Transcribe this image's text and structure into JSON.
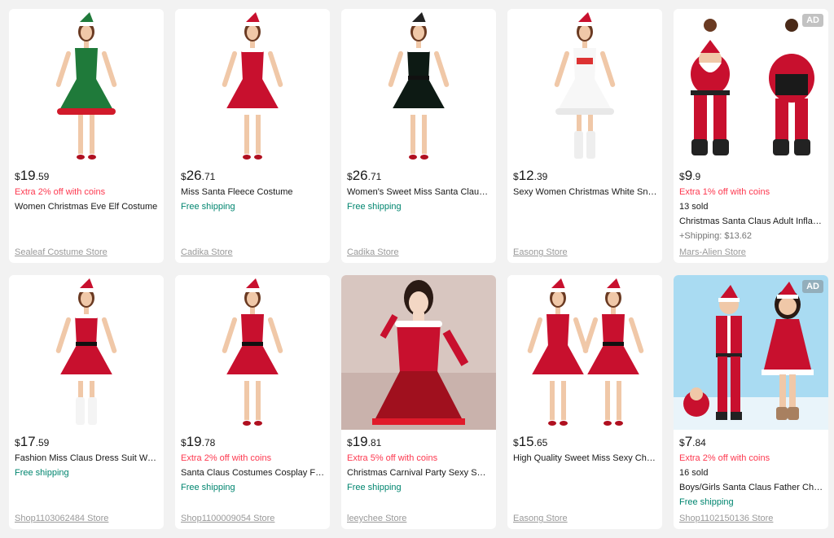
{
  "ad_label": "AD",
  "products": [
    {
      "cur": "$",
      "int": "19",
      "dec": ".59",
      "lines": [
        {
          "kind": "promo",
          "text": "Extra 2% off with coins"
        },
        {
          "kind": "title",
          "text": "Women Christmas Eve Elf Costume"
        }
      ],
      "store": "Sealeaf Costume Store",
      "ad": false,
      "image": "green-elf-dress"
    },
    {
      "cur": "$",
      "int": "26",
      "dec": ".71",
      "lines": [
        {
          "kind": "title",
          "text": "Miss Santa Fleece Costume"
        },
        {
          "kind": "ship-free",
          "text": "Free shipping"
        }
      ],
      "store": "Cadika Store",
      "ad": false,
      "image": "red-santa-dress-cape"
    },
    {
      "cur": "$",
      "int": "26",
      "dec": ".71",
      "lines": [
        {
          "kind": "title",
          "text": "Women's Sweet Miss Santa Claus Costume"
        },
        {
          "kind": "ship-free",
          "text": "Free shipping"
        }
      ],
      "store": "Cadika Store",
      "ad": false,
      "image": "black-velvet-dress"
    },
    {
      "cur": "$",
      "int": "12",
      "dec": ".39",
      "lines": [
        {
          "kind": "title",
          "text": "Sexy Women Christmas White Snowflake"
        }
      ],
      "store": "Easong Store",
      "ad": false,
      "image": "white-candy-dress"
    },
    {
      "cur": "$",
      "int": "9",
      "dec": ".9",
      "lines": [
        {
          "kind": "promo",
          "text": "Extra 1% off with coins"
        },
        {
          "kind": "sold",
          "text": "13 sold"
        },
        {
          "kind": "title",
          "text": "Christmas Santa Claus Adult Inflatable"
        },
        {
          "kind": "ship-cost",
          "text": "+Shipping: $13.62"
        }
      ],
      "store": "Mars-Alien Store",
      "ad": true,
      "image": "inflatable-santa"
    },
    {
      "cur": "$",
      "int": "17",
      "dec": ".59",
      "lines": [
        {
          "kind": "title",
          "text": "Fashion Miss Claus Dress Suit Women"
        },
        {
          "kind": "ship-free",
          "text": "Free shipping"
        }
      ],
      "store": "Shop1103062484 Store",
      "ad": false,
      "image": "red-tube-dress"
    },
    {
      "cur": "$",
      "int": "19",
      "dec": ".78",
      "lines": [
        {
          "kind": "promo",
          "text": "Extra 2% off with coins"
        },
        {
          "kind": "title",
          "text": "Santa Claus Costumes Cosplay Fashion"
        },
        {
          "kind": "ship-free",
          "text": "Free shipping"
        }
      ],
      "store": "Shop1100009054 Store",
      "ad": false,
      "image": "red-hooded-dress"
    },
    {
      "cur": "$",
      "int": "19",
      "dec": ".81",
      "lines": [
        {
          "kind": "promo",
          "text": "Extra 5% off with coins"
        },
        {
          "kind": "title",
          "text": "Christmas Carnival Party Sexy Sweet"
        },
        {
          "kind": "ship-free",
          "text": "Free shipping"
        }
      ],
      "store": "leeychee Store",
      "ad": false,
      "image": "red-mesh-dress"
    },
    {
      "cur": "$",
      "int": "15",
      "dec": ".65",
      "lines": [
        {
          "kind": "title",
          "text": "High Quality Sweet Miss Sexy Christmas"
        }
      ],
      "store": "Easong Store",
      "ad": false,
      "image": "two-santa-dresses"
    },
    {
      "cur": "$",
      "int": "7",
      "dec": ".84",
      "lines": [
        {
          "kind": "promo",
          "text": "Extra 2% off with coins"
        },
        {
          "kind": "sold",
          "text": "16 sold"
        },
        {
          "kind": "title",
          "text": "Boys/Girls Santa Claus Father Christmas"
        },
        {
          "kind": "ship-free",
          "text": "Free shipping"
        }
      ],
      "store": "Shop1102150136 Store",
      "ad": true,
      "image": "kids-santa-costumes"
    }
  ]
}
